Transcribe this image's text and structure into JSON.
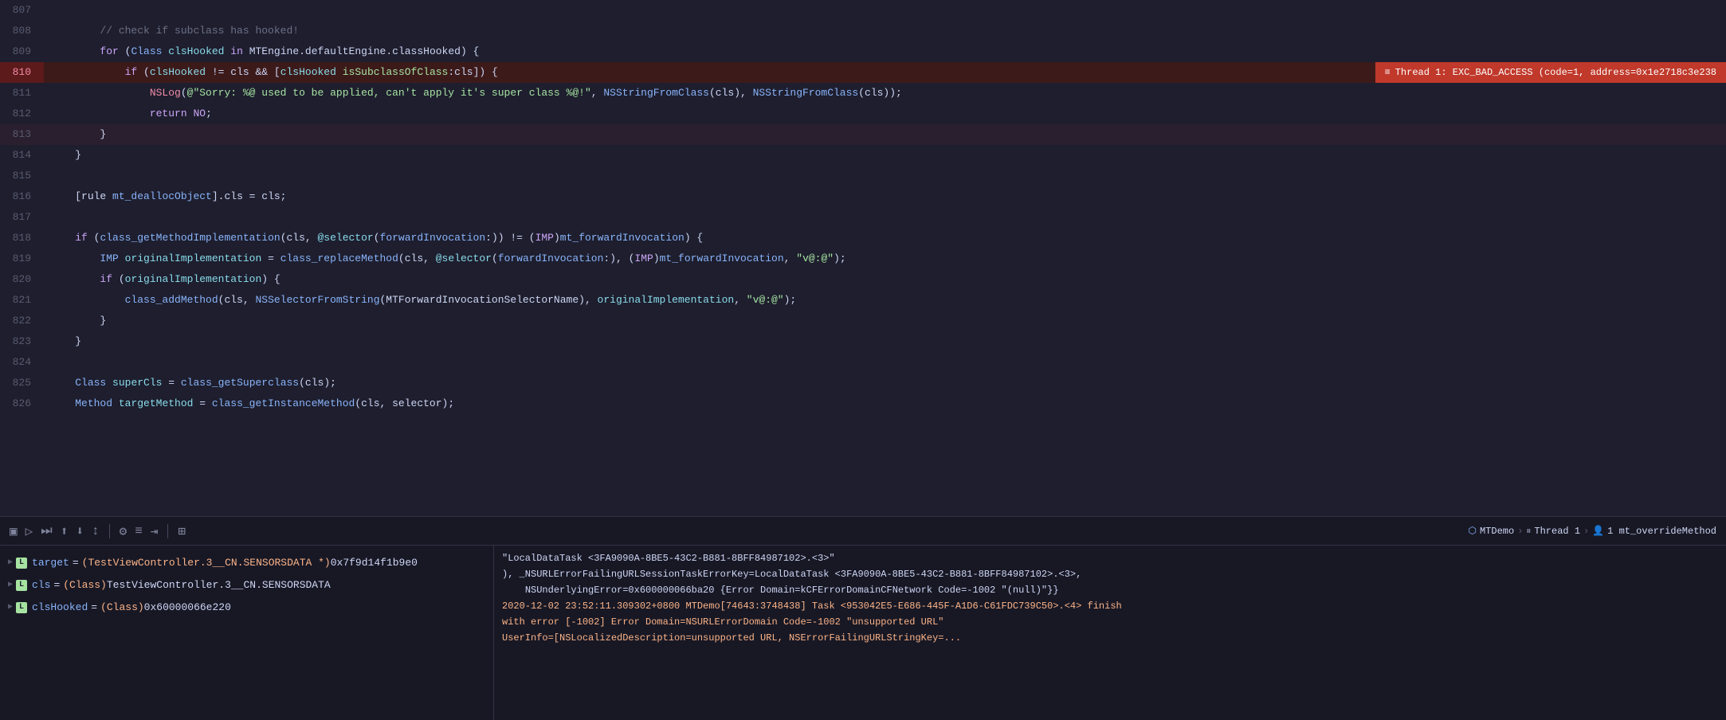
{
  "editor": {
    "lines": [
      {
        "num": "807",
        "tokens": [],
        "raw": "",
        "highlighted": false,
        "error": false
      },
      {
        "num": "808",
        "tokens": [
          {
            "t": "spaces",
            "v": "        "
          },
          {
            "t": "cm-text",
            "v": "// check if subclass has hooked!"
          }
        ],
        "error": false
      },
      {
        "num": "809",
        "tokens": [
          {
            "t": "spaces",
            "v": "        "
          },
          {
            "t": "kw",
            "v": "for"
          },
          {
            "t": "op",
            "v": " ("
          },
          {
            "t": "type",
            "v": "Class"
          },
          {
            "t": "var",
            "v": " "
          },
          {
            "t": "cyan",
            "v": "clsHooked"
          },
          {
            "t": "var",
            "v": " "
          },
          {
            "t": "kw",
            "v": "in"
          },
          {
            "t": "var",
            "v": " MTEngine.defaultEngine.classHooked) {"
          }
        ],
        "error": false
      },
      {
        "num": "810",
        "tokens": [
          {
            "t": "spaces",
            "v": "            "
          },
          {
            "t": "kw",
            "v": "if"
          },
          {
            "t": "var",
            "v": " ("
          },
          {
            "t": "cyan",
            "v": "clsHooked"
          },
          {
            "t": "var",
            "v": " != "
          },
          {
            "t": "var",
            "v": "cls && ["
          },
          {
            "t": "cyan",
            "v": "clsHooked"
          },
          {
            "t": "var",
            "v": " "
          },
          {
            "t": "green",
            "v": "isSubclassOfClass"
          },
          {
            "t": "var",
            "v": ":cls]) {"
          }
        ],
        "error": true,
        "errorMsg": "Thread 1: EXC_BAD_ACCESS (code=1, address=0x1e2718c3e238"
      },
      {
        "num": "811",
        "tokens": [
          {
            "t": "spaces",
            "v": "                "
          },
          {
            "t": "macro",
            "v": "NSLog"
          },
          {
            "t": "var",
            "v": "("
          },
          {
            "t": "str",
            "v": "@\"Sorry: %@ used to be applied, can't apply it's super class %@!\""
          },
          {
            "t": "var",
            "v": ", "
          },
          {
            "t": "fn",
            "v": "NSStringFromClass"
          },
          {
            "t": "var",
            "v": "(cls), "
          },
          {
            "t": "fn",
            "v": "NSStringFromClass"
          },
          {
            "t": "var",
            "v": "(cls));"
          }
        ],
        "error": false
      },
      {
        "num": "812",
        "tokens": [
          {
            "t": "spaces",
            "v": "                "
          },
          {
            "t": "kw",
            "v": "return"
          },
          {
            "t": "var",
            "v": " "
          },
          {
            "t": "kw",
            "v": "NO"
          },
          {
            "t": "var",
            "v": ";"
          }
        ],
        "error": false
      },
      {
        "num": "813",
        "tokens": [
          {
            "t": "spaces",
            "v": "        "
          },
          {
            "t": "var",
            "v": "}"
          }
        ],
        "highlighted": true,
        "error": false
      },
      {
        "num": "814",
        "tokens": [
          {
            "t": "spaces",
            "v": "    "
          },
          {
            "t": "var",
            "v": "}"
          }
        ],
        "error": false
      },
      {
        "num": "815",
        "tokens": [],
        "error": false
      },
      {
        "num": "816",
        "tokens": [
          {
            "t": "spaces",
            "v": "    "
          },
          {
            "t": "var",
            "v": "[rule "
          },
          {
            "t": "fn",
            "v": "mt_deallocObject"
          },
          {
            "t": "var",
            "v": "].cls = cls;"
          }
        ],
        "error": false
      },
      {
        "num": "817",
        "tokens": [],
        "error": false
      },
      {
        "num": "818",
        "tokens": [
          {
            "t": "spaces",
            "v": "    "
          },
          {
            "t": "kw",
            "v": "if"
          },
          {
            "t": "var",
            "v": " ("
          },
          {
            "t": "fn",
            "v": "class_getMethodImplementation"
          },
          {
            "t": "var",
            "v": "(cls, "
          },
          {
            "t": "selector",
            "v": "@selector"
          },
          {
            "t": "var",
            "v": "("
          },
          {
            "t": "fn",
            "v": "forwardInvocation"
          },
          {
            "t": "var",
            "v": ":)) != ("
          },
          {
            "t": "cast",
            "v": "IMP"
          },
          {
            "t": "var",
            "v": ")"
          },
          {
            "t": "fn",
            "v": "mt_forwardInvocation"
          },
          {
            "t": "var",
            "v": ") {"
          }
        ],
        "error": false
      },
      {
        "num": "819",
        "tokens": [
          {
            "t": "spaces",
            "v": "        "
          },
          {
            "t": "type",
            "v": "IMP"
          },
          {
            "t": "var",
            "v": " "
          },
          {
            "t": "cyan",
            "v": "originalImplementation"
          },
          {
            "t": "var",
            "v": " = "
          },
          {
            "t": "fn",
            "v": "class_replaceMethod"
          },
          {
            "t": "var",
            "v": "(cls, "
          },
          {
            "t": "selector",
            "v": "@selector"
          },
          {
            "t": "var",
            "v": "("
          },
          {
            "t": "fn",
            "v": "forwardInvocation"
          },
          {
            "t": "var",
            "v": ":), ("
          },
          {
            "t": "cast",
            "v": "IMP"
          },
          {
            "t": "var",
            "v": ")"
          },
          {
            "t": "fn",
            "v": "mt_forwardInvocation"
          },
          {
            "t": "var",
            "v": ", "
          },
          {
            "t": "str",
            "v": "\"v@:@\""
          },
          {
            "t": "var",
            "v": ");"
          }
        ],
        "error": false
      },
      {
        "num": "820",
        "tokens": [
          {
            "t": "spaces",
            "v": "        "
          },
          {
            "t": "kw",
            "v": "if"
          },
          {
            "t": "var",
            "v": " ("
          },
          {
            "t": "cyan",
            "v": "originalImplementation"
          },
          {
            "t": "var",
            "v": ") {"
          }
        ],
        "error": false
      },
      {
        "num": "821",
        "tokens": [
          {
            "t": "spaces",
            "v": "            "
          },
          {
            "t": "fn",
            "v": "class_addMethod"
          },
          {
            "t": "var",
            "v": "(cls, "
          },
          {
            "t": "fn",
            "v": "NSSelectorFromString"
          },
          {
            "t": "var",
            "v": "(MTForwardInvocationSelectorName), "
          },
          {
            "t": "cyan",
            "v": "originalImplementation"
          },
          {
            "t": "var",
            "v": ", "
          },
          {
            "t": "str",
            "v": "\"v@:@\""
          },
          {
            "t": "var",
            "v": ");"
          }
        ],
        "error": false
      },
      {
        "num": "822",
        "tokens": [
          {
            "t": "spaces",
            "v": "        "
          },
          {
            "t": "var",
            "v": "}"
          }
        ],
        "error": false
      },
      {
        "num": "823",
        "tokens": [
          {
            "t": "spaces",
            "v": "    "
          },
          {
            "t": "var",
            "v": "}"
          }
        ],
        "error": false
      },
      {
        "num": "824",
        "tokens": [],
        "error": false
      },
      {
        "num": "825",
        "tokens": [
          {
            "t": "spaces",
            "v": "    "
          },
          {
            "t": "type",
            "v": "Class"
          },
          {
            "t": "var",
            "v": " "
          },
          {
            "t": "cyan",
            "v": "superCls"
          },
          {
            "t": "var",
            "v": " = "
          },
          {
            "t": "fn",
            "v": "class_getSuperclass"
          },
          {
            "t": "var",
            "v": "(cls);"
          }
        ],
        "error": false
      },
      {
        "num": "826",
        "tokens": [
          {
            "t": "spaces",
            "v": "    "
          },
          {
            "t": "type",
            "v": "Method"
          },
          {
            "t": "var",
            "v": " "
          },
          {
            "t": "cyan",
            "v": "targetMethod"
          },
          {
            "t": "var",
            "v": " = "
          },
          {
            "t": "fn",
            "v": "class_getInstanceMethod"
          },
          {
            "t": "var",
            "v": "(cls, selector);"
          }
        ],
        "error": false
      }
    ]
  },
  "toolbar": {
    "icons": [
      "▣",
      "▷",
      "⏭",
      "⬆",
      "⬇",
      "⬆⬇",
      "⎗",
      "⚙",
      "≡",
      "⇥"
    ],
    "path": {
      "app": "MTDemo",
      "thread": "Thread 1",
      "person_icon": "👤",
      "method": "1 mt_overrideMethod"
    }
  },
  "debug": {
    "variables": [
      {
        "type": "L",
        "name": "target",
        "equals": "=",
        "value_type": "(TestViewController.3__CN.SENSORSDATA *)",
        "value": "0x7f9d14f1b9e0"
      },
      {
        "type": "L",
        "name": "cls",
        "equals": "=",
        "value_type": "(Class)",
        "value": "TestViewController.3__CN.SENSORSDATA"
      },
      {
        "type": "L",
        "name": "clsHooked",
        "equals": "=",
        "value_type": "(Class)",
        "value": "0x60000066e220"
      }
    ],
    "console_lines": [
      {
        "cls": "white-text",
        "text": "\"LocalDataTask <3FA9090A-8BE5-43C2-B881-8BFF84987102>.<3>\""
      },
      {
        "cls": "white-text",
        "text": "), _NSURLErrorFailingURLSessionTaskErrorKey=LocalDataTask <3FA9090A-8BE5-43C2-B881-8BFF84987102>.<3>,"
      },
      {
        "cls": "white-text",
        "text": "    NSUnderlyingError=0x600000066ba20 {Error Domain=kCFErrorDomainCFNetwork Code=-1002 \"(null)\"}}"
      },
      {
        "cls": "orange-text",
        "text": "2020-12-02 23:52:11.309302+0800 MTDemo[74643:3748438] Task <953042E5-E686-445F-A1D6-C61FDC739C50>.<4> finish"
      },
      {
        "cls": "orange-text",
        "text": "with error [-1002] Error Domain=NSURLErrorDomain Code=-1002 \"unsupported URL\""
      },
      {
        "cls": "orange-text",
        "text": "UserInfo=[NSLocalizedDescription=unsupported URL, NSErrorFailingURLStringKey=..."
      }
    ]
  }
}
